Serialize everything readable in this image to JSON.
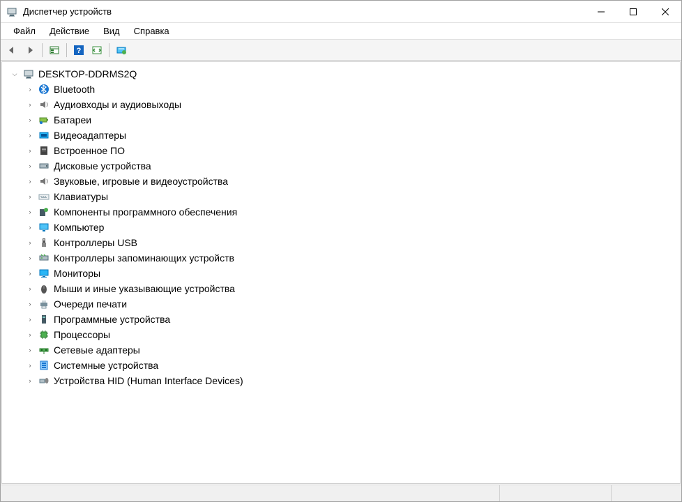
{
  "window": {
    "title": "Диспетчер устройств"
  },
  "menu": {
    "items": [
      {
        "label": "Файл"
      },
      {
        "label": "Действие"
      },
      {
        "label": "Вид"
      },
      {
        "label": "Справка"
      }
    ]
  },
  "toolbar": {
    "back_tip": "Назад",
    "forward_tip": "Вперед",
    "properties_tip": "Свойства",
    "help_tip": "Справка",
    "scan_tip": "Обновить конфигурацию оборудования",
    "show_hidden_tip": "Показать скрытые устройства"
  },
  "tree": {
    "root": {
      "label": "DESKTOP-DDRMS2Q",
      "icon": "computer-root"
    },
    "categories": [
      {
        "label": "Bluetooth",
        "icon": "bluetooth"
      },
      {
        "label": "Аудиовходы и аудиовыходы",
        "icon": "audio"
      },
      {
        "label": "Батареи",
        "icon": "battery"
      },
      {
        "label": "Видеоадаптеры",
        "icon": "display-adapter"
      },
      {
        "label": "Встроенное ПО",
        "icon": "firmware"
      },
      {
        "label": "Дисковые устройства",
        "icon": "disk"
      },
      {
        "label": "Звуковые, игровые и видеоустройства",
        "icon": "sound"
      },
      {
        "label": "Клавиатуры",
        "icon": "keyboard"
      },
      {
        "label": "Компоненты программного обеспечения",
        "icon": "software-component"
      },
      {
        "label": "Компьютер",
        "icon": "computer"
      },
      {
        "label": "Контроллеры USB",
        "icon": "usb"
      },
      {
        "label": "Контроллеры запоминающих устройств",
        "icon": "storage-controller"
      },
      {
        "label": "Мониторы",
        "icon": "monitor"
      },
      {
        "label": "Мыши и иные указывающие устройства",
        "icon": "mouse"
      },
      {
        "label": "Очереди печати",
        "icon": "printer"
      },
      {
        "label": "Программные устройства",
        "icon": "software-device"
      },
      {
        "label": "Процессоры",
        "icon": "processor"
      },
      {
        "label": "Сетевые адаптеры",
        "icon": "network"
      },
      {
        "label": "Системные устройства",
        "icon": "system"
      },
      {
        "label": "Устройства HID (Human Interface Devices)",
        "icon": "hid"
      }
    ]
  }
}
